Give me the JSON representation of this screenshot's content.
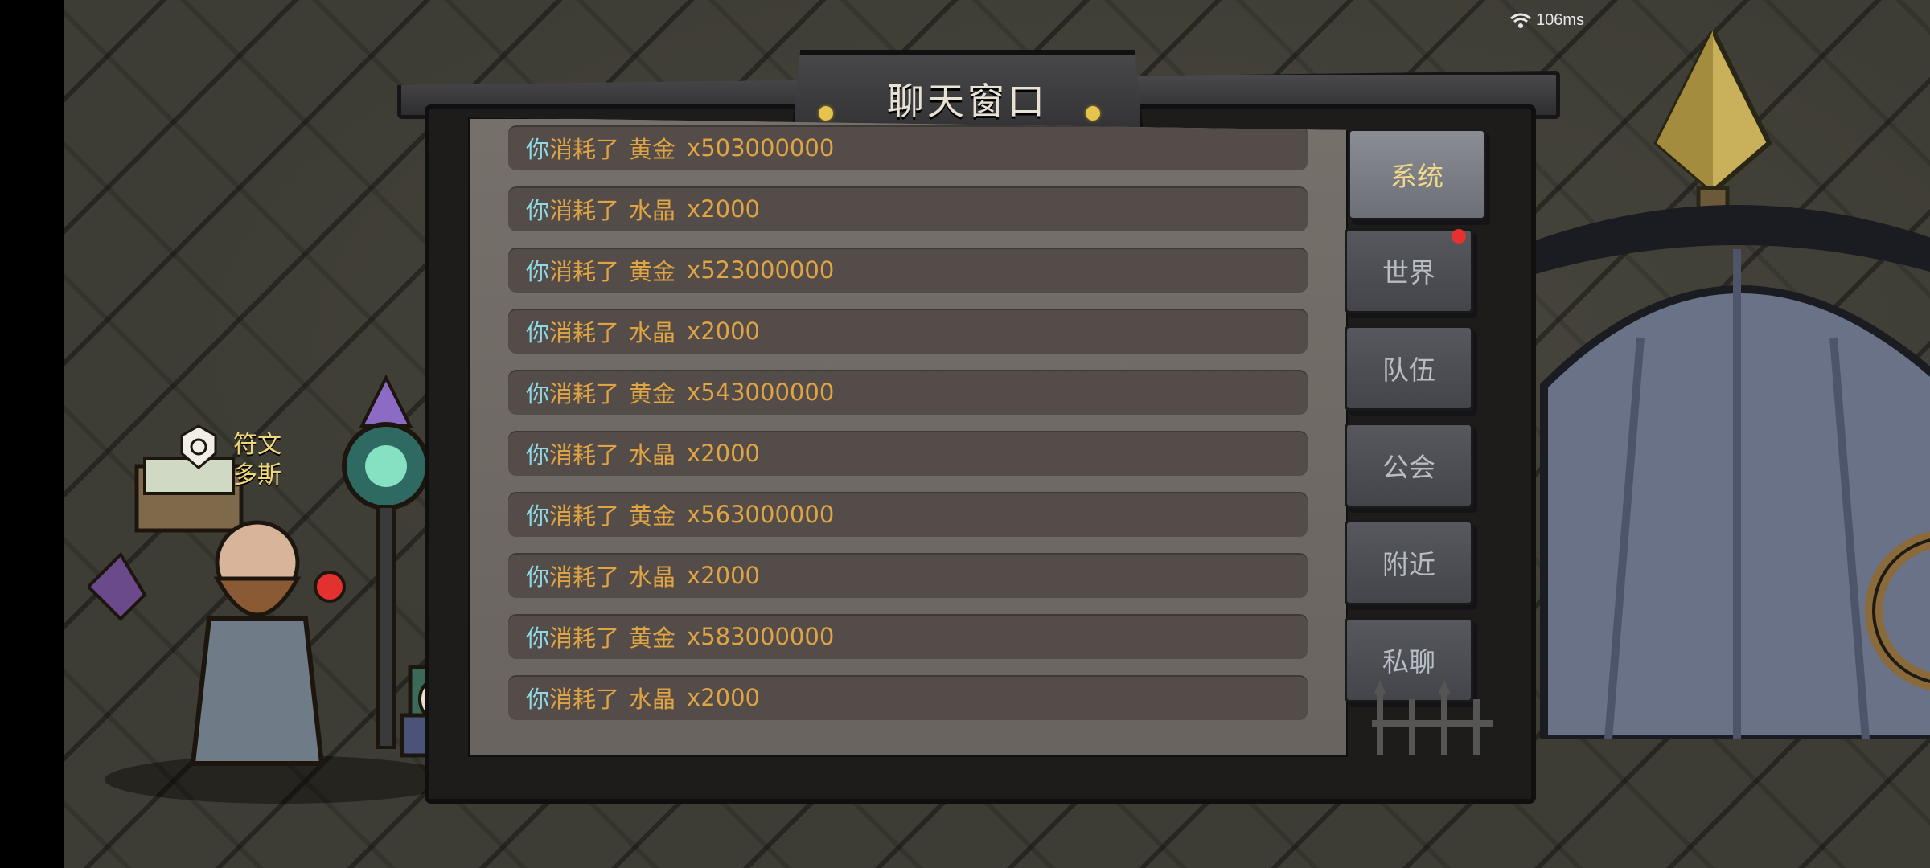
{
  "status": {
    "wifi_icon": "wifi-icon",
    "latency": "106ms"
  },
  "window": {
    "title": "聊天窗口"
  },
  "npc": {
    "label_line1": "符文",
    "label_line2": "多斯"
  },
  "messages": [
    {
      "subject": "你",
      "verb": "消耗了",
      "item": "黄金",
      "qty": "x503000000"
    },
    {
      "subject": "你",
      "verb": "消耗了",
      "item": "水晶",
      "qty": "x2000"
    },
    {
      "subject": "你",
      "verb": "消耗了",
      "item": "黄金",
      "qty": "x523000000"
    },
    {
      "subject": "你",
      "verb": "消耗了",
      "item": "水晶",
      "qty": "x2000"
    },
    {
      "subject": "你",
      "verb": "消耗了",
      "item": "黄金",
      "qty": "x543000000"
    },
    {
      "subject": "你",
      "verb": "消耗了",
      "item": "水晶",
      "qty": "x2000"
    },
    {
      "subject": "你",
      "verb": "消耗了",
      "item": "黄金",
      "qty": "x563000000"
    },
    {
      "subject": "你",
      "verb": "消耗了",
      "item": "水晶",
      "qty": "x2000"
    },
    {
      "subject": "你",
      "verb": "消耗了",
      "item": "黄金",
      "qty": "x583000000"
    },
    {
      "subject": "你",
      "verb": "消耗了",
      "item": "水晶",
      "qty": "x2000"
    }
  ],
  "tabs": [
    {
      "label": "系统",
      "active": true,
      "badge": false
    },
    {
      "label": "世界",
      "active": false,
      "badge": true
    },
    {
      "label": "队伍",
      "active": false,
      "badge": false
    },
    {
      "label": "公会",
      "active": false,
      "badge": false
    },
    {
      "label": "附近",
      "active": false,
      "badge": false
    },
    {
      "label": "私聊",
      "active": false,
      "badge": false
    }
  ],
  "colors": {
    "subject": "#8fd8e4",
    "message_text": "#e0a444",
    "active_tab_text": "#f2d98a",
    "tab_text": "#b8bcc4",
    "badge": "#e8312e",
    "title_dot": "#e6c34d"
  }
}
